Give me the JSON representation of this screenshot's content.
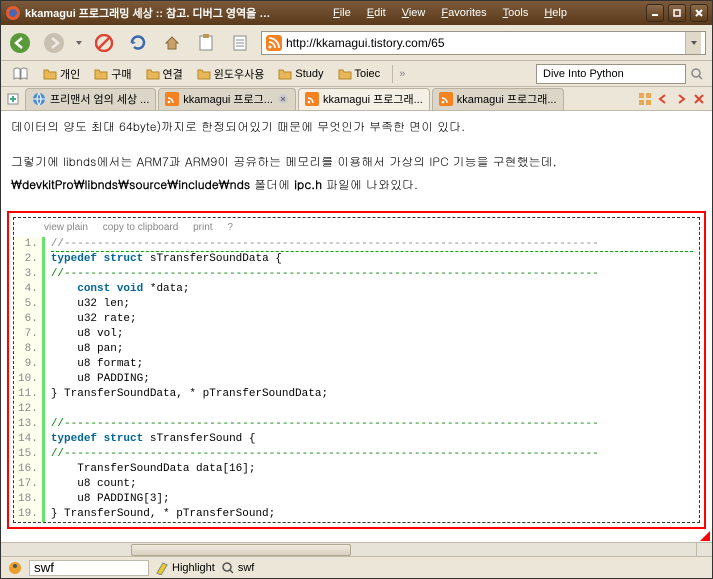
{
  "window": {
    "title": "kkamagui 프로그래밍 세상 :: 참고. 디버그 영역을 이용한..."
  },
  "menu": {
    "file": "File",
    "edit": "Edit",
    "view": "View",
    "favorites": "Favorites",
    "tools": "Tools",
    "help": "Help"
  },
  "url": "http://kkamagui.tistory.com/65",
  "bookmarks": {
    "b0": "개인",
    "b1": "구매",
    "b2": "연결",
    "b3": "윈도우사용",
    "b4": "Study",
    "b5": "Toiec"
  },
  "search": {
    "placeholder": "",
    "value": "Dive Into Python"
  },
  "tabs": {
    "t0": "프리맨서 엄의 세상 ...",
    "t1": "kkamagui 프로그...",
    "t2": "kkamagui 프로그래...",
    "t3": "kkamagui 프로그래..."
  },
  "article": {
    "p1": "데이터의 양도 최대 64byte)까지로 한정되어있기 때문에 무엇인가 부족한 면이 있다.",
    "p2": "그렇기에 libnds에서는 ARM7과 ARM9이 공유하는 메모리를 이용해서 가상의 IPC 기능을 구현했는데,",
    "p3a": "₩devkitPro₩libnds₩source₩include₩nds",
    "p3b": " 폴더에 ",
    "p3c": "ipc.h",
    "p3d": " 파일에 나와있다."
  },
  "codetoolbar": {
    "viewplain": "view plain",
    "copy": "copy to clipboard",
    "print": "print",
    "help": "?"
  },
  "code": {
    "l1": "//---------------------------------------------------------------------------------",
    "l2a": "typedef",
    "l2b": " struct",
    "l2c": " sTransferSoundData {",
    "l3": "//---------------------------------------------------------------------------------",
    "l4a": "    const",
    "l4b": " void",
    "l4c": " *data;",
    "l5": "    u32 len;",
    "l6": "    u32 rate;",
    "l7": "    u8 vol;",
    "l8": "    u8 pan;",
    "l9": "    u8 format;",
    "l10": "    u8 PADDING;",
    "l11": "} TransferSoundData, * pTransferSoundData;",
    "l12": "",
    "l13": "//---------------------------------------------------------------------------------",
    "l14a": "typedef",
    "l14b": " struct",
    "l14c": " sTransferSound {",
    "l15": "//---------------------------------------------------------------------------------",
    "l16": "    TransferSoundData data[16];",
    "l17": "    u8 count;",
    "l18": "    u8 PADDING[3];",
    "l19": "} TransferSound, * pTransferSound;"
  },
  "status": {
    "input1": "swf",
    "highlight": "Highlight",
    "input2": "swf"
  },
  "ln": {
    "l1": "1.",
    "l2": "2.",
    "l3": "3.",
    "l4": "4.",
    "l5": "5.",
    "l6": "6.",
    "l7": "7.",
    "l8": "8.",
    "l9": "9.",
    "l10": "10.",
    "l11": "11.",
    "l12": "12.",
    "l13": "13.",
    "l14": "14.",
    "l15": "15.",
    "l16": "16.",
    "l17": "17.",
    "l18": "18.",
    "l19": "19."
  }
}
